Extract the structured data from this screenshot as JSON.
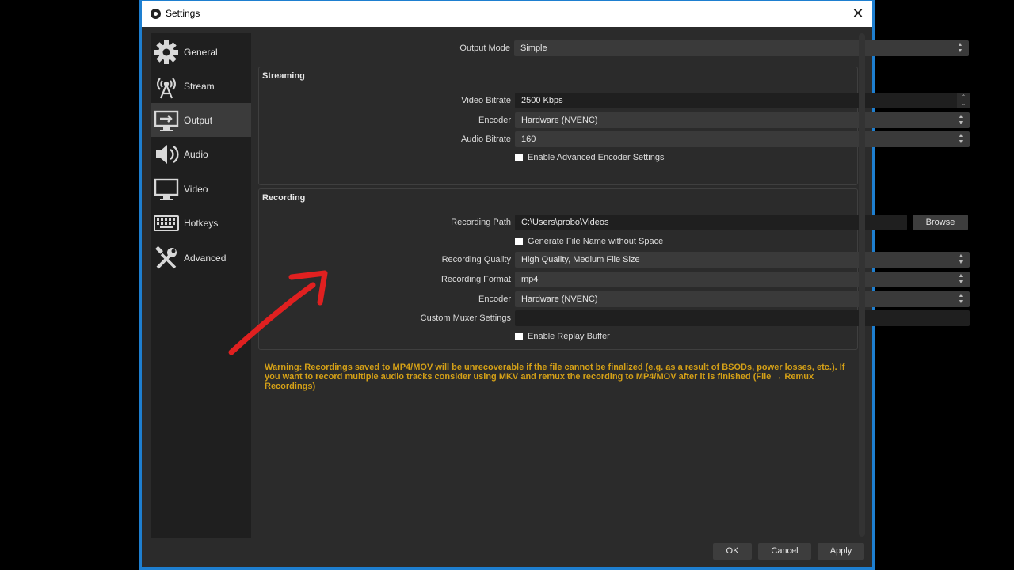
{
  "window": {
    "title": "Settings"
  },
  "sidebar": {
    "items": [
      {
        "label": "General",
        "icon": "gear-icon"
      },
      {
        "label": "Stream",
        "icon": "antenna-icon"
      },
      {
        "label": "Output",
        "icon": "output-monitor-icon",
        "active": true
      },
      {
        "label": "Audio",
        "icon": "speaker-icon"
      },
      {
        "label": "Video",
        "icon": "monitor-icon"
      },
      {
        "label": "Hotkeys",
        "icon": "keyboard-icon"
      },
      {
        "label": "Advanced",
        "icon": "tools-icon"
      }
    ]
  },
  "output_mode": {
    "label": "Output Mode",
    "value": "Simple"
  },
  "streaming": {
    "title": "Streaming",
    "video_bitrate": {
      "label": "Video Bitrate",
      "value": "2500 Kbps"
    },
    "encoder": {
      "label": "Encoder",
      "value": "Hardware (NVENC)"
    },
    "audio_bitrate": {
      "label": "Audio Bitrate",
      "value": "160"
    },
    "advanced_encoder": {
      "label": "Enable Advanced Encoder Settings",
      "checked": false
    }
  },
  "recording": {
    "title": "Recording",
    "path": {
      "label": "Recording Path",
      "value": "C:\\Users\\probo\\Videos",
      "browse_label": "Browse"
    },
    "no_space": {
      "label": "Generate File Name without Space",
      "checked": false
    },
    "quality": {
      "label": "Recording Quality",
      "value": "High Quality, Medium File Size"
    },
    "format": {
      "label": "Recording Format",
      "value": "mp4"
    },
    "encoder": {
      "label": "Encoder",
      "value": "Hardware (NVENC)"
    },
    "muxer": {
      "label": "Custom Muxer Settings",
      "value": ""
    },
    "replay_buffer": {
      "label": "Enable Replay Buffer",
      "checked": false
    }
  },
  "warning": "Warning: Recordings saved to MP4/MOV will be unrecoverable if the file cannot be finalized (e.g. as a result of BSODs, power losses, etc.). If you want to record multiple audio tracks consider using MKV and remux the recording to MP4/MOV after it is finished (File → Remux Recordings)",
  "footer": {
    "ok": "OK",
    "cancel": "Cancel",
    "apply": "Apply"
  },
  "colors": {
    "accent": "#1e7fd0",
    "warning": "#d4a017",
    "annotation_arrow": "#e02020"
  }
}
